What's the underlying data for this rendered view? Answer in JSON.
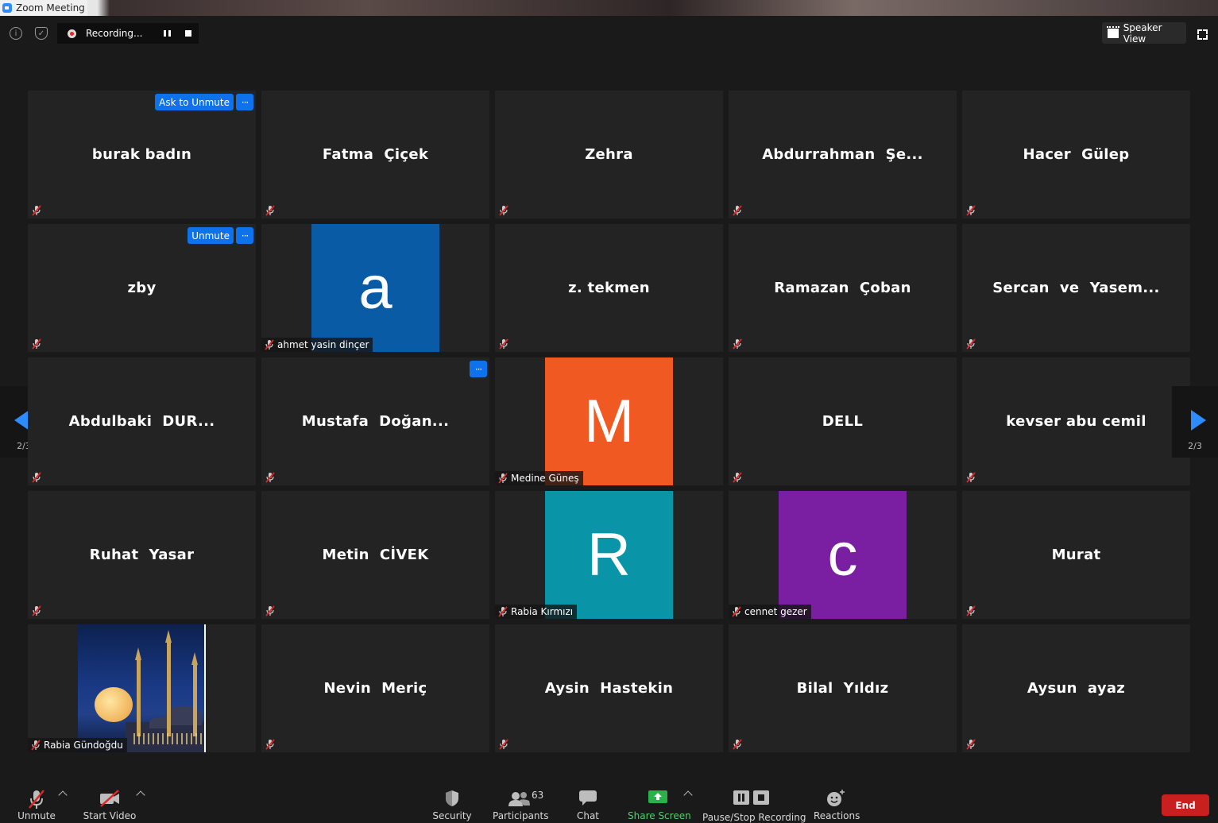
{
  "window": {
    "title": "Zoom Meeting"
  },
  "topbar": {
    "recording_label": "Recording...",
    "speaker_view_label": "Speaker View"
  },
  "pagination": {
    "left_label": "2/3",
    "right_label": "2/3"
  },
  "participants": [
    {
      "name": "burak badın",
      "muted": true,
      "overlay_button": "Ask to Unmute",
      "overlay_more": "···"
    },
    {
      "name": "Fatma  Çiçek",
      "muted": true
    },
    {
      "name": "Zehra",
      "muted": true
    },
    {
      "name": "Abdurrahman  Şe...",
      "muted": true
    },
    {
      "name": "Hacer  Gülep",
      "muted": true
    },
    {
      "name": "zby",
      "muted": true,
      "overlay_button": "Unmute",
      "overlay_more": "···"
    },
    {
      "name": "ahmet yasin dinçer",
      "muted": true,
      "avatar_letter": "a",
      "avatar_color": "#0a5ba5"
    },
    {
      "name": "z. tekmen",
      "muted": true
    },
    {
      "name": "Ramazan  Çoban",
      "muted": true
    },
    {
      "name": "Sercan  ve  Yasem...",
      "muted": true
    },
    {
      "name": "Abdulbaki  DUR...",
      "muted": true
    },
    {
      "name": "Mustafa  Doğan...",
      "muted": true,
      "overlay_more": "···"
    },
    {
      "name": "Medine Güneş",
      "muted": true,
      "avatar_letter": "M",
      "avatar_color": "#f05a22"
    },
    {
      "name": "DELL",
      "muted": true
    },
    {
      "name": "kevser abu cemil",
      "muted": true
    },
    {
      "name": "Ruhat  Yasar",
      "muted": true
    },
    {
      "name": "Metin  CİVEK",
      "muted": true
    },
    {
      "name": "Rabia Kırmızı",
      "muted": true,
      "avatar_letter": "R",
      "avatar_color": "#0a94a8"
    },
    {
      "name": "cennet gezer",
      "muted": true,
      "avatar_letter": "c",
      "avatar_color": "#7b1fa2"
    },
    {
      "name": "Murat",
      "muted": true
    },
    {
      "name": "Rabia Gündoğdu",
      "muted": true,
      "avatar_image": "mosque-moon-photo"
    },
    {
      "name": "Nevin  Meriç",
      "muted": true
    },
    {
      "name": "Aysin  Hastekin",
      "muted": true
    },
    {
      "name": "Bilal  Yıldız",
      "muted": true
    },
    {
      "name": "Aysun  ayaz",
      "muted": true
    }
  ],
  "toolbar": {
    "unmute": "Unmute",
    "start_video": "Start Video",
    "security": "Security",
    "participants": "Participants",
    "participants_count": "63",
    "chat": "Chat",
    "share_screen": "Share Screen",
    "pause_stop_recording": "Pause/Stop Recording",
    "reactions": "Reactions",
    "end": "End"
  },
  "colors": {
    "accent_blue": "#0e72ed",
    "share_green": "#2ab24a",
    "end_red": "#c8201e",
    "muted_mic_red": "#e02828"
  }
}
